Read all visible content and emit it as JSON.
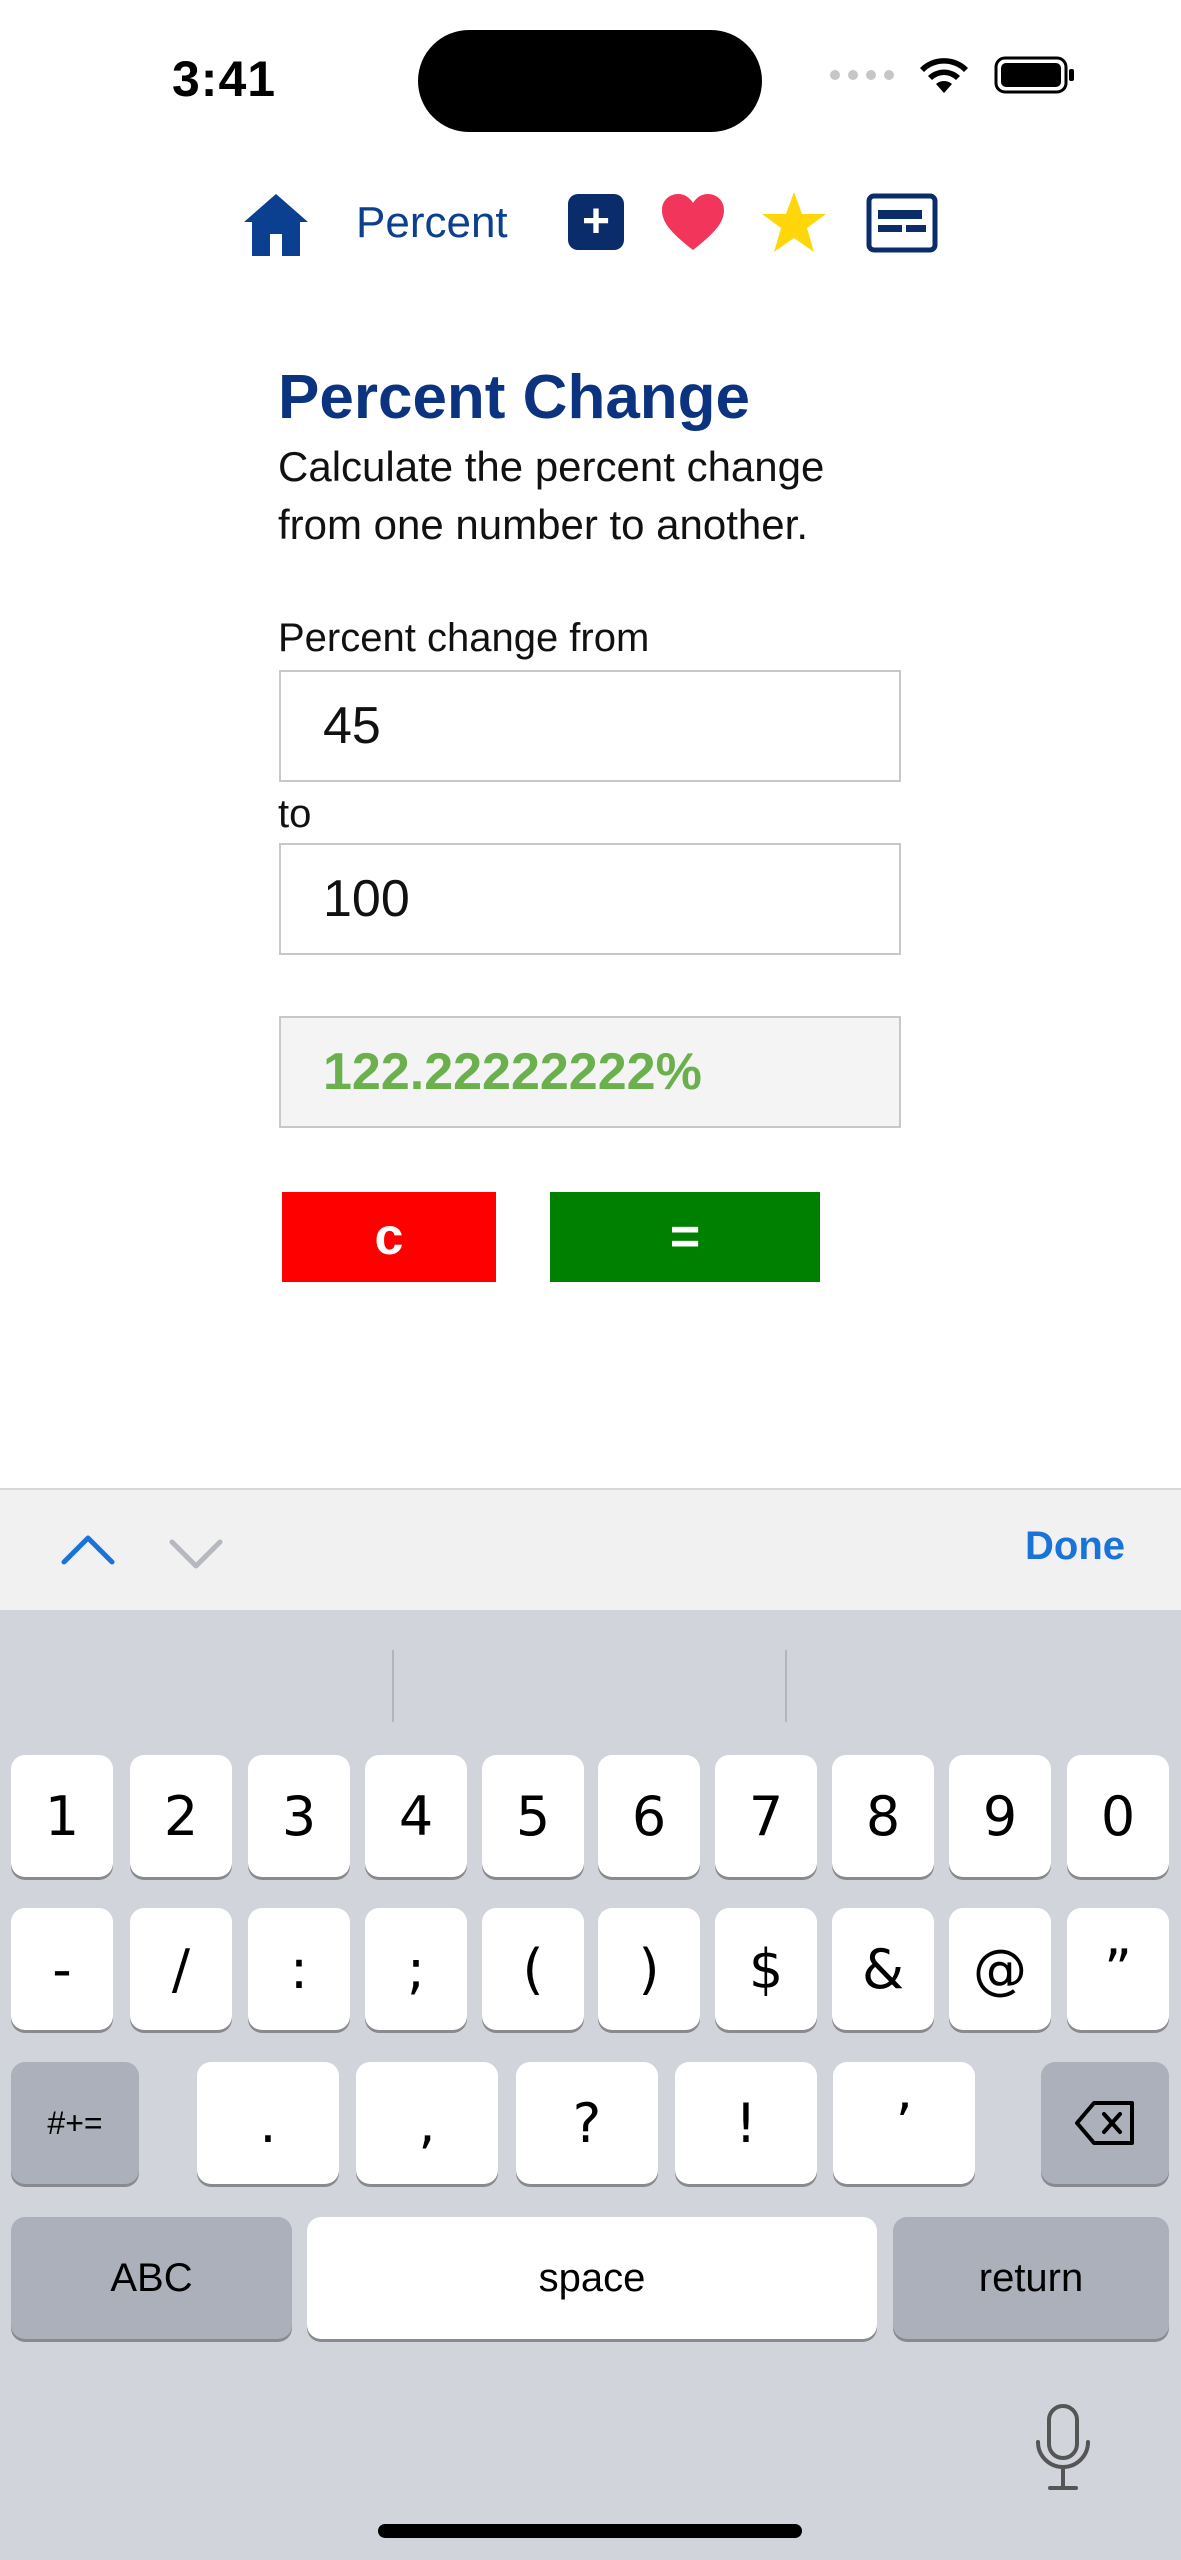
{
  "status": {
    "time": "3:41"
  },
  "nav": {
    "title": "Percent",
    "plus_symbol": "+",
    "icons": [
      "home-icon",
      "add-icon",
      "heart-icon",
      "star-icon",
      "card-icon"
    ]
  },
  "page": {
    "title": "Percent Change",
    "description": "Calculate the percent change from one number to another.",
    "from_label": "Percent change from",
    "from_value": "45",
    "to_label": "to",
    "to_value": "100",
    "result": "122.22222222%",
    "clear_label": "c",
    "equals_label": "="
  },
  "accessory": {
    "done_label": "Done"
  },
  "keyboard": {
    "row1": [
      "1",
      "2",
      "3",
      "4",
      "5",
      "6",
      "7",
      "8",
      "9",
      "0"
    ],
    "row2": [
      "-",
      "/",
      ":",
      ";",
      "(",
      ")",
      "$",
      "&",
      "@",
      "”"
    ],
    "row3": [
      ".",
      ",",
      "?",
      "!",
      "’"
    ],
    "symbols_label": "#+=",
    "abc_label": "ABC",
    "space_label": "space",
    "return_label": "return"
  },
  "colors": {
    "title": "#0b3380",
    "result": "#6ab04c",
    "clear_button": "#ff0000",
    "equals_button": "#008000",
    "done": "#1a73d9"
  }
}
